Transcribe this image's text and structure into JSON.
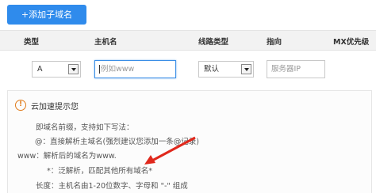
{
  "toolbar": {
    "add_subdomain_label": "+添加子域名"
  },
  "table_header": {
    "type": "类型",
    "host": "主机名",
    "line_type": "线路类型",
    "target": "指向",
    "mx_priority": "MX优先级"
  },
  "form": {
    "type_value": "A",
    "host_placeholder": "例如www",
    "line_value": "默认",
    "target_placeholder": "服务器IP"
  },
  "tip": {
    "title": "云加速提示您",
    "intro": "即域名前缀，支持如下写法：",
    "line_at": "@：直接解析主域名(强烈建议您添加一条@记录)",
    "line_www": "www：解析后的域名为www.",
    "line_wildcard": "*：泛解析，匹配其他所有域名*",
    "line_length": "长度：主机名由1-20位数字、字母和 \"-\" 组成"
  },
  "colors": {
    "primary_button": "#2f8bec",
    "warning": "#e07b1a",
    "annotation_arrow": "#e0281c"
  },
  "icons": {
    "warning": "exclamation-circle-icon",
    "dropdown": "chevron-down-icon"
  }
}
